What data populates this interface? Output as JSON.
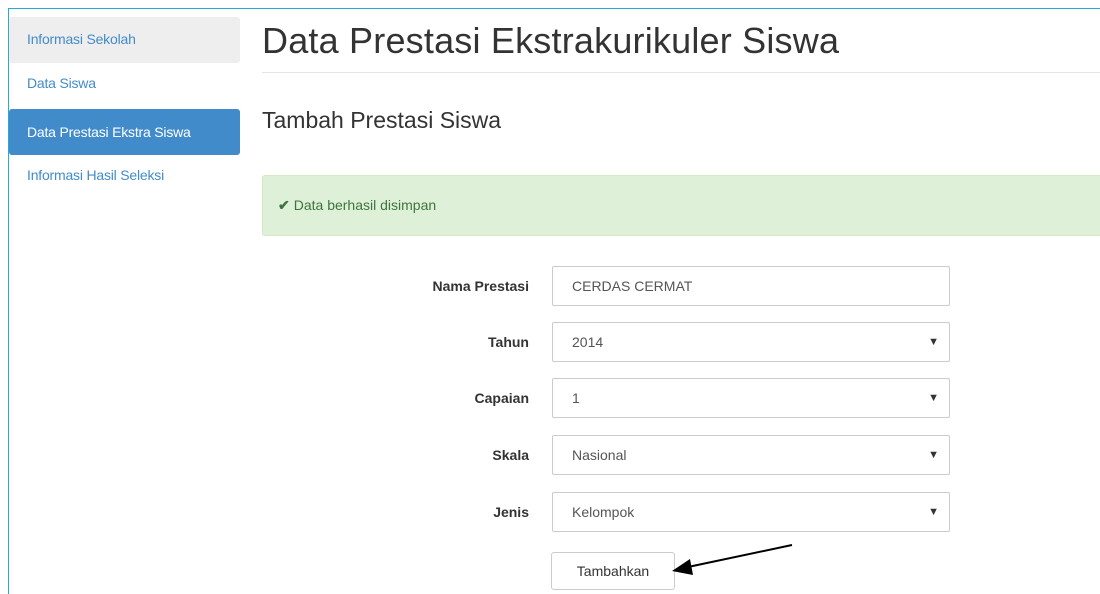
{
  "sidebar": {
    "items": [
      {
        "label": "Informasi Sekolah"
      },
      {
        "label": "Data Siswa"
      },
      {
        "label": "Data Prestasi Ekstra Siswa"
      },
      {
        "label": "Informasi Hasil Seleksi"
      }
    ],
    "active_index": 2,
    "accent_color": "#428bca"
  },
  "page": {
    "title": "Data Prestasi Ekstrakurikuler Siswa",
    "subtitle": "Tambah Prestasi Siswa"
  },
  "alert": {
    "icon": "check-icon",
    "text": "Data berhasil disimpan",
    "color": "#dff0d8"
  },
  "form": {
    "nama_prestasi": {
      "label": "Nama Prestasi",
      "value": "CERDAS CERMAT"
    },
    "tahun": {
      "label": "Tahun",
      "value": "2014"
    },
    "capaian": {
      "label": "Capaian",
      "value": "1"
    },
    "skala": {
      "label": "Skala",
      "value": "Nasional"
    },
    "jenis": {
      "label": "Jenis",
      "value": "Kelompok"
    },
    "submit_label": "Tambahkan"
  }
}
